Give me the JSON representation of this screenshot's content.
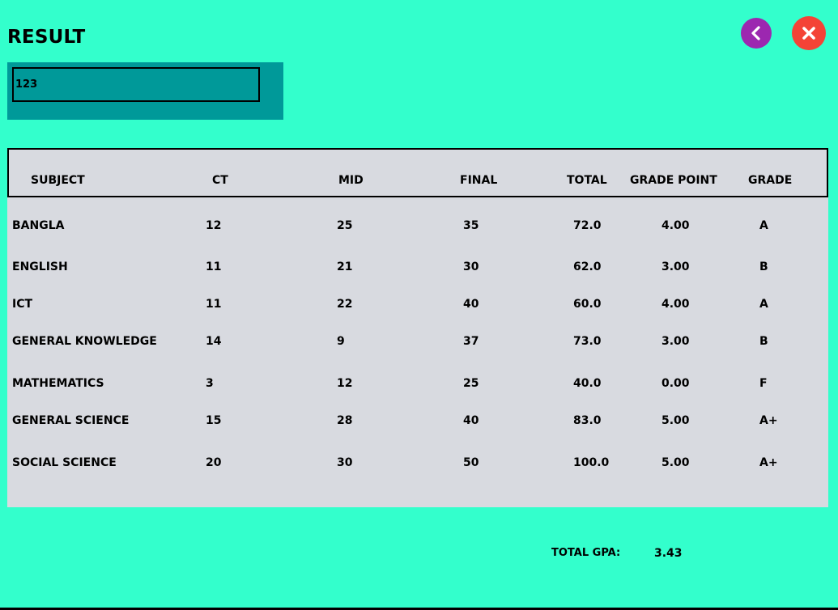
{
  "page": {
    "title": "RESULT"
  },
  "search": {
    "value": "123"
  },
  "table": {
    "headers": {
      "subject": "SUBJECT",
      "ct": "CT",
      "mid": "MID",
      "final": "FINAL",
      "total": "TOTAL",
      "grade_point": "GRADE POINT",
      "grade": "GRADE"
    },
    "rows": [
      {
        "subject": "BANGLA",
        "ct": "12",
        "mid": "25",
        "final": "35",
        "total": "72.0",
        "grade_point": "4.00",
        "grade": "A"
      },
      {
        "subject": "ENGLISH",
        "ct": "11",
        "mid": "21",
        "final": "30",
        "total": "62.0",
        "grade_point": "3.00",
        "grade": "B"
      },
      {
        "subject": "ICT",
        "ct": "11",
        "mid": "22",
        "final": "40",
        "total": "60.0",
        "grade_point": "4.00",
        "grade": "A"
      },
      {
        "subject": "GENERAL KNOWLEDGE",
        "ct": "14",
        "mid": "9",
        "final": "37",
        "total": "73.0",
        "grade_point": "3.00",
        "grade": "B"
      },
      {
        "subject": "MATHEMATICS",
        "ct": "3",
        "mid": "12",
        "final": "25",
        "total": "40.0",
        "grade_point": "0.00",
        "grade": "F"
      },
      {
        "subject": "GENERAL SCIENCE",
        "ct": "15",
        "mid": "28",
        "final": "40",
        "total": "83.0",
        "grade_point": "5.00",
        "grade": "A+"
      },
      {
        "subject": "SOCIAL SCIENCE",
        "ct": "20",
        "mid": "30",
        "final": "50",
        "total": "100.0",
        "grade_point": "5.00",
        "grade": "A+"
      }
    ]
  },
  "summary": {
    "gpa_label": "TOTAL GPA:",
    "gpa_value": "3.43"
  },
  "colors": {
    "background": "#33ffcc",
    "search_panel": "#009999",
    "table": "#d8dae0",
    "back_button": "#9c27b0",
    "close_button": "#f44336"
  },
  "icons": {
    "back": "chevron-left-icon",
    "close": "close-icon"
  }
}
